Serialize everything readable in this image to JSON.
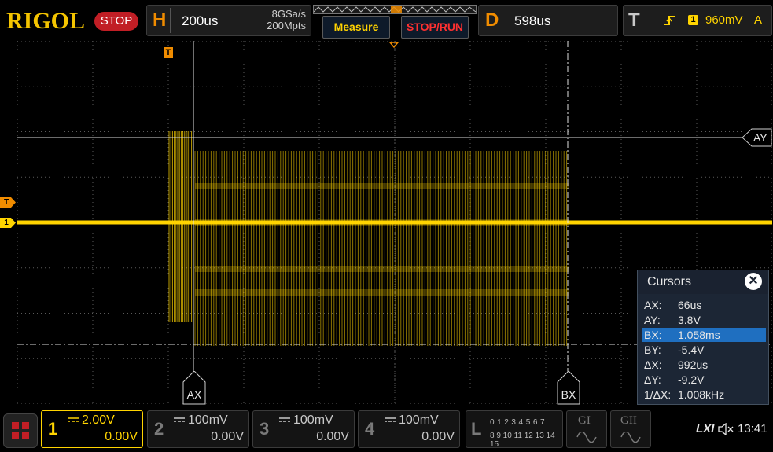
{
  "brand": "RIGOL",
  "run_state": "STOP",
  "horizontal": {
    "letter": "H",
    "timebase": "200us",
    "sample_rate": "8GSa/s",
    "memory_depth": "200Mpts"
  },
  "buttons": {
    "measure": "Measure",
    "stop_run": "STOP/RUN"
  },
  "delay": {
    "letter": "D",
    "value": "598us"
  },
  "trigger": {
    "letter": "T",
    "source": "1",
    "level": "960mV",
    "mode": "A"
  },
  "markers": {
    "trigger_top": "T",
    "trigger_left": "T",
    "channel1_left": "1"
  },
  "cursor_labels": {
    "ax": "AX",
    "bx": "BX",
    "ay": "AY"
  },
  "cursors_panel": {
    "title": "Cursors",
    "close_icon": "close-icon",
    "rows": [
      {
        "key": "AX:",
        "value": "66us",
        "selected": false
      },
      {
        "key": "AY:",
        "value": "3.8V",
        "selected": false
      },
      {
        "key": "BX:",
        "value": "1.058ms",
        "selected": true
      },
      {
        "key": "BY:",
        "value": "-5.4V",
        "selected": false
      },
      {
        "key": "ΔX:",
        "value": "992us",
        "selected": false
      },
      {
        "key": "ΔY:",
        "value": "-9.2V",
        "selected": false
      },
      {
        "key": "1/ΔX:",
        "value": "1.008kHz",
        "selected": false
      }
    ]
  },
  "channels": [
    {
      "num": "1",
      "scale": "2.00V",
      "offset": "0.00V",
      "active": true,
      "color": "#ffd400"
    },
    {
      "num": "2",
      "scale": "100mV",
      "offset": "0.00V",
      "active": false,
      "color": "#7a7a7a"
    },
    {
      "num": "3",
      "scale": "100mV",
      "offset": "0.00V",
      "active": false,
      "color": "#7a7a7a"
    },
    {
      "num": "4",
      "scale": "100mV",
      "offset": "0.00V",
      "active": false,
      "color": "#7a7a7a"
    }
  ],
  "logic": {
    "letter": "L",
    "row1": "0 1 2 3  4 5 6 7",
    "row2": "8 9 10 11 12 13 14 15"
  },
  "generators": {
    "g1": "GI",
    "g2": "GII"
  },
  "status": {
    "lxi": "LXI",
    "time": "13:41"
  },
  "colors": {
    "ch1": "#ffd400",
    "accent_orange": "#f08c00",
    "selected_row": "#1f6fc0",
    "stop_red": "#c11e25"
  }
}
